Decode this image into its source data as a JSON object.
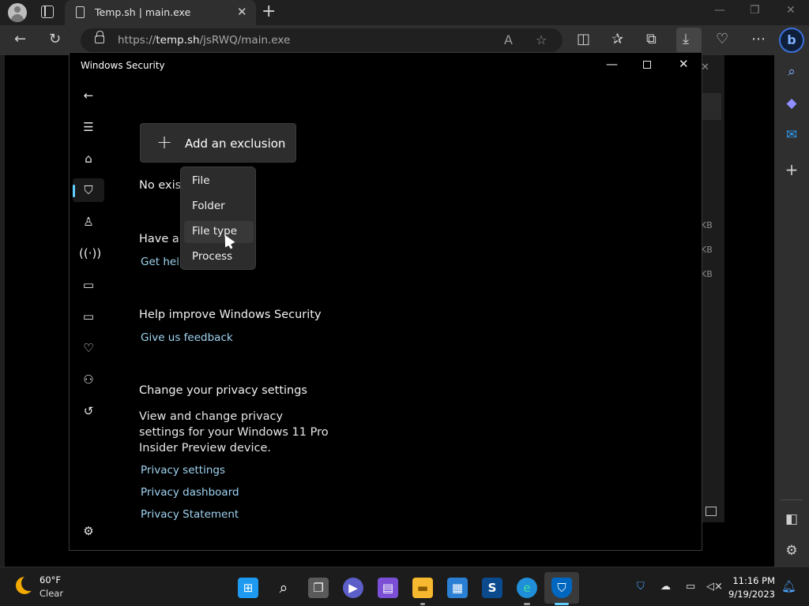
{
  "browser": {
    "tab_title": "Temp.sh | main.exe",
    "tab_close": "✕",
    "new_tab": "+",
    "url_prefix": "https://",
    "url_host": "temp.sh",
    "url_path": "/jsRWQ/main.exe",
    "bing_label": "b",
    "window_minimize": "—",
    "window_restore": "❐",
    "window_close": "✕"
  },
  "security_window": {
    "title": "Windows Security",
    "minimize": "—",
    "close": "✕",
    "add_exclusion_plus": "+",
    "add_exclusion_label": "Add an exclusion",
    "no_existing": "No exist",
    "have_question": "Have a q",
    "get_help": "Get help",
    "improve_heading": "Help improve Windows Security",
    "give_feedback": "Give us feedback",
    "privacy_heading": "Change your privacy settings",
    "privacy_text": "View and change privacy settings for your Windows 11 Pro Insider Preview device.",
    "privacy_links": [
      "Privacy settings",
      "Privacy dashboard",
      "Privacy Statement"
    ],
    "menu_items": [
      "File",
      "Folder",
      "File type",
      "Process"
    ],
    "hovered_item": "File type"
  },
  "background_marks": [
    "✕",
    "KB",
    "KB",
    "KB"
  ],
  "taskbar": {
    "temperature": "60°F",
    "condition": "Clear",
    "time": "11:16 PM",
    "date": "9/19/2023"
  },
  "colors": {
    "accent": "#60cdff",
    "link": "#9fd4f2",
    "security_blue": "#0067c0"
  }
}
